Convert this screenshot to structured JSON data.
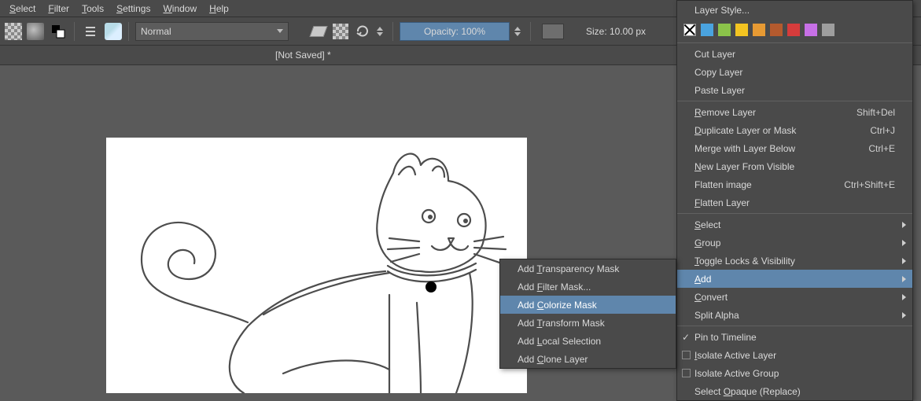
{
  "menu": {
    "items": [
      "Select",
      "Filter",
      "Tools",
      "Settings",
      "Window",
      "Help"
    ],
    "underlines": [
      "S",
      "F",
      "T",
      "S",
      "W",
      "H"
    ]
  },
  "toolbar": {
    "blend_mode": "Normal",
    "opacity_label": "Opacity: 100%",
    "size_label": "Size: 10.00 px"
  },
  "document": {
    "title": "[Not Saved]  *"
  },
  "layer_menu": {
    "swatches": [
      "#ffffff",
      "#4aa3df",
      "#8bc34a",
      "#f3c421",
      "#e79a33",
      "#b45a2e",
      "#d63c3c",
      "#c770e6",
      "#9e9e9e"
    ],
    "items": [
      {
        "label": "Layer Style...",
        "type": "item"
      },
      {
        "type": "swatches"
      },
      {
        "label": "Cut Layer",
        "type": "item"
      },
      {
        "label": "Copy Layer",
        "type": "item"
      },
      {
        "label": "Paste Layer",
        "type": "item"
      },
      {
        "type": "sep"
      },
      {
        "label": "Remove Layer",
        "u": "R",
        "shortcut": "Shift+Del",
        "type": "item"
      },
      {
        "label": "Duplicate Layer or Mask",
        "u": "D",
        "shortcut": "Ctrl+J",
        "type": "item"
      },
      {
        "label": "Merge with Layer Below",
        "shortcut": "Ctrl+E",
        "type": "item"
      },
      {
        "label": "New Layer From Visible",
        "u": "N",
        "type": "item"
      },
      {
        "label": "Flatten image",
        "shortcut": "Ctrl+Shift+E",
        "type": "item"
      },
      {
        "label": "Flatten Layer",
        "u": "F",
        "type": "item"
      },
      {
        "type": "sep"
      },
      {
        "label": "Select",
        "u": "S",
        "type": "sub"
      },
      {
        "label": "Group",
        "u": "G",
        "type": "sub"
      },
      {
        "label": "Toggle Locks & Visibility",
        "u": "T",
        "type": "sub"
      },
      {
        "label": "Add",
        "u": "A",
        "type": "sub",
        "hover": true
      },
      {
        "label": "Convert",
        "u": "C",
        "type": "sub"
      },
      {
        "label": "Split Alpha",
        "type": "sub"
      },
      {
        "type": "sep"
      },
      {
        "label": "Pin to Timeline",
        "type": "check",
        "checked": true
      },
      {
        "label": "Isolate Active Layer",
        "u": "I",
        "type": "box"
      },
      {
        "label": "Isolate Active Group",
        "type": "box"
      },
      {
        "label": "Select Opaque (Replace)",
        "u": "O",
        "type": "item"
      }
    ]
  },
  "add_menu": {
    "items": [
      {
        "label": "Add Transparency Mask",
        "u": "T"
      },
      {
        "label": "Add Filter Mask...",
        "u": "F"
      },
      {
        "label": "Add Colorize Mask",
        "u": "C",
        "hover": true
      },
      {
        "label": "Add Transform Mask",
        "u": "T"
      },
      {
        "label": "Add Local Selection",
        "u": "L"
      },
      {
        "label": "Add Clone Layer",
        "u": "C"
      }
    ]
  }
}
